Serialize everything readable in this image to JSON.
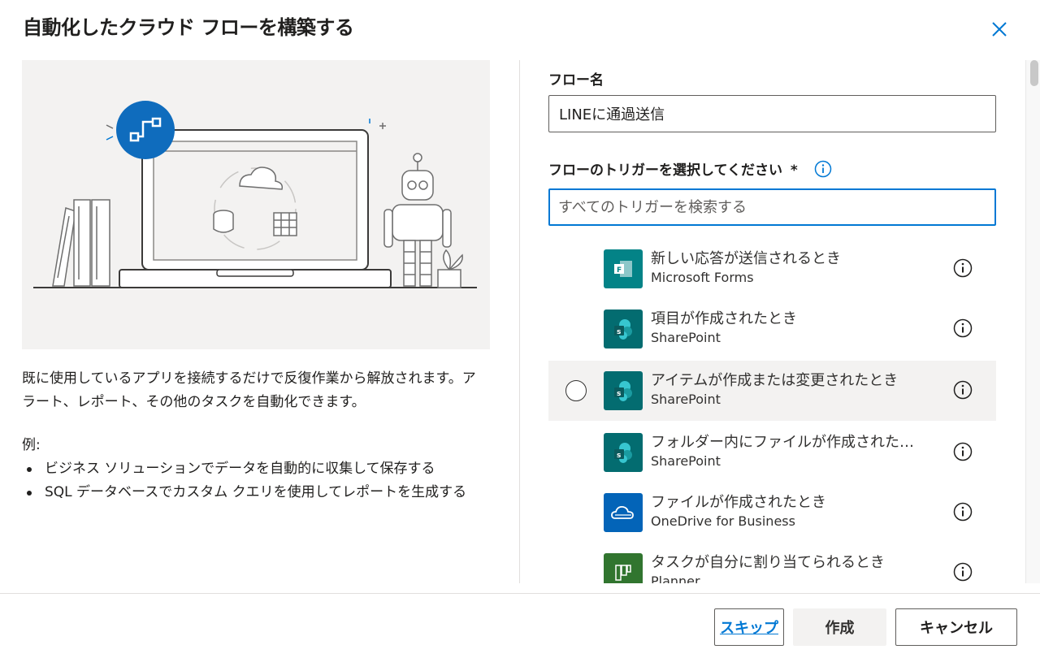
{
  "dialog": {
    "title": "自動化したクラウド フローを構築する"
  },
  "left": {
    "description": "既に使用しているアプリを接続するだけで反復作業から解放されます。アラート、レポート、その他のタスクを自動化できます。",
    "examples_heading": "例:",
    "examples": [
      "ビジネス ソリューションでデータを自動的に収集して保存する",
      "SQL データベースでカスタム クエリを使用してレポートを生成する"
    ]
  },
  "form": {
    "flow_name_label": "フロー名",
    "flow_name_value": "LINEに通過送信",
    "trigger_label": "フローのトリガーを選択してください",
    "required_mark": "*",
    "search_placeholder": "すべてのトリガーを検索する"
  },
  "triggers": [
    {
      "name": "新しい応答が送信されるとき",
      "connector": "Microsoft Forms",
      "icon": "forms-icon",
      "color": "#038387"
    },
    {
      "name": "項目が作成されたとき",
      "connector": "SharePoint",
      "icon": "sharepoint-icon",
      "color": "#036c70"
    },
    {
      "name": "アイテムが作成または変更されたとき",
      "connector": "SharePoint",
      "icon": "sharepoint-icon",
      "color": "#036c70"
    },
    {
      "name": "フォルダー内にファイルが作成されたとき",
      "connector": "SharePoint",
      "icon": "sharepoint-icon",
      "color": "#036c70"
    },
    {
      "name": "ファイルが作成されたとき",
      "connector": "OneDrive for Business",
      "icon": "onedrive-icon",
      "color": "#0364b8"
    },
    {
      "name": "タスクが自分に割り当てられるとき",
      "connector": "Planner",
      "icon": "planner-icon",
      "color": "#31752f"
    }
  ],
  "footer": {
    "skip": "スキップ",
    "create": "作成",
    "cancel": "キャンセル"
  },
  "colors": {
    "accent": "#0078d4"
  }
}
